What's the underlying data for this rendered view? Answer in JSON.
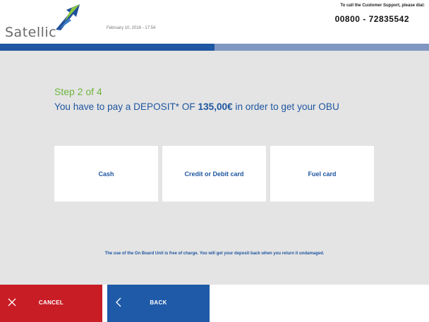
{
  "header": {
    "logo_text": "Satellic",
    "datetime": "February 10, 2016 - 17:54",
    "support_label": "To call the Customer Support, please dial:",
    "support_phone": "00800 - 72835542"
  },
  "progress": {
    "fraction": 0.5
  },
  "main": {
    "step": "Step 2 of 4",
    "headline_prefix": "You have to pay a DEPOSIT* OF ",
    "headline_amount": "135,00€",
    "headline_suffix": " in order to get your OBU",
    "options": [
      {
        "label": "Cash"
      },
      {
        "label": "Credit or Debit card"
      },
      {
        "label": "Fuel card"
      }
    ],
    "note": "The use of the On Board Unit is free of charge. You will get your deposit back when you return it undamaged."
  },
  "footer": {
    "cancel_label": "CANCEL",
    "back_label": "BACK"
  },
  "colors": {
    "brand_blue": "#1f56a0",
    "step_green": "#6fb53e",
    "cancel_red": "#c81d25",
    "back_blue": "#1e5aa8",
    "background_gray": "#e4e4e4"
  },
  "icons": {
    "logo": "satellic-arrow-logo-icon",
    "cancel": "close-icon",
    "back": "chevron-left-icon"
  }
}
